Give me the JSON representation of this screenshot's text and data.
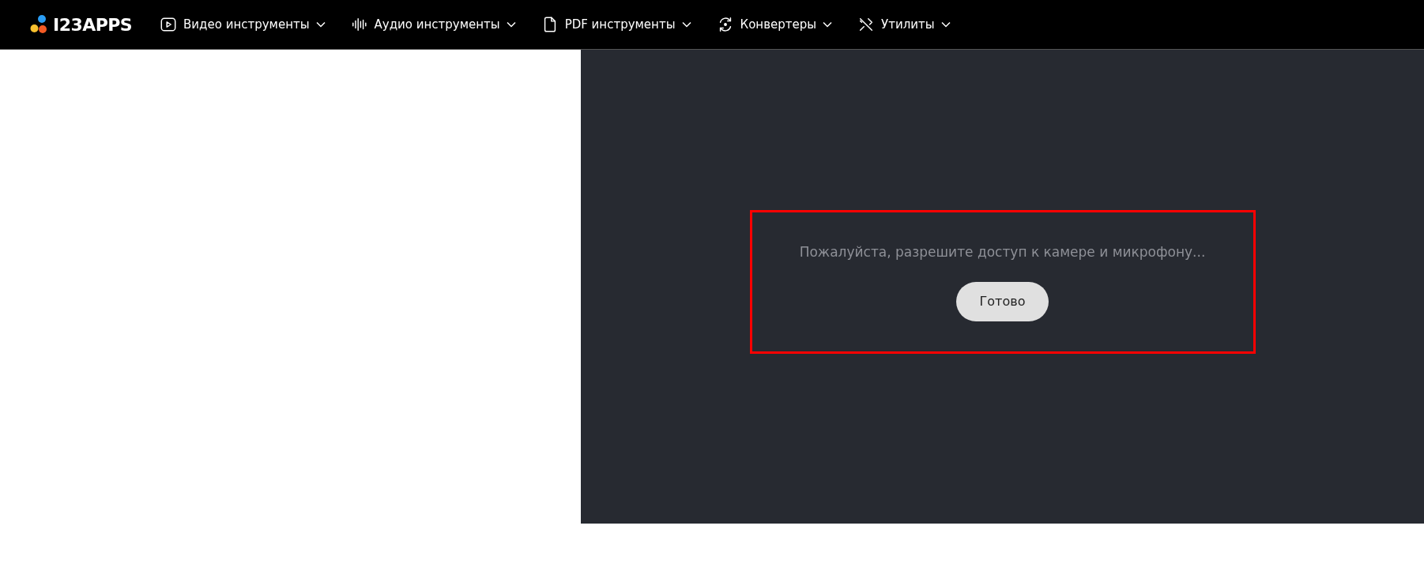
{
  "header": {
    "logo": "I23APPS",
    "nav": [
      {
        "kind": "video",
        "label": "Видео инструменты"
      },
      {
        "kind": "audio",
        "label": "Аудио инструменты"
      },
      {
        "kind": "pdf",
        "label": "PDF инструменты"
      },
      {
        "kind": "converter",
        "label": "Конвертеры"
      },
      {
        "kind": "utilities",
        "label": "Утилиты"
      }
    ]
  },
  "recorder": {
    "message": "Пожалуйста, разрешите доступ к камере и микрофону...",
    "button": "Готово"
  }
}
